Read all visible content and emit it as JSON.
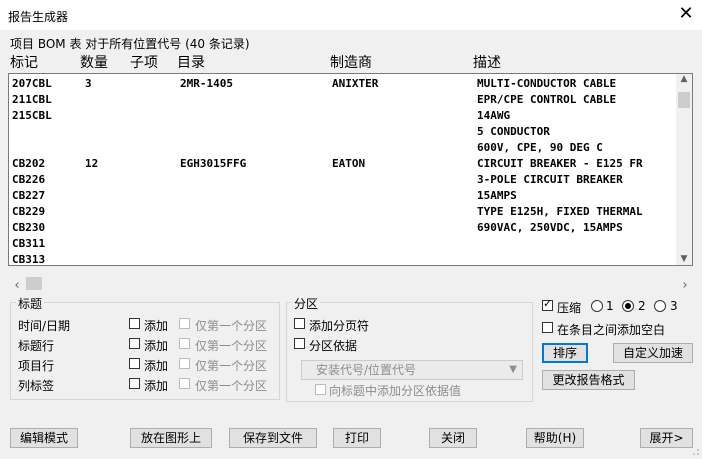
{
  "window": {
    "title": "报告生成器",
    "close": "✕"
  },
  "subtitle": "项目 BOM 表 对于所有位置代号 (40 条记录)",
  "columns": [
    "标记",
    "数量",
    "子项",
    "目录",
    "制造商",
    "描述"
  ],
  "rows": [
    {
      "tag": "207CBL",
      "qty": "3",
      "sub": "",
      "cat": "2MR-1405",
      "mfr": "ANIXTER",
      "desc": "MULTI-CONDUCTOR CABLE"
    },
    {
      "tag": "211CBL",
      "qty": "",
      "sub": "",
      "cat": "",
      "mfr": "",
      "desc": "EPR/CPE CONTROL CABLE"
    },
    {
      "tag": "215CBL",
      "qty": "",
      "sub": "",
      "cat": "",
      "mfr": "",
      "desc": "14AWG"
    },
    {
      "tag": "",
      "qty": "",
      "sub": "",
      "cat": "",
      "mfr": "",
      "desc": "5 CONDUCTOR"
    },
    {
      "tag": "",
      "qty": "",
      "sub": "",
      "cat": "",
      "mfr": "",
      "desc": "600V,  CPE, 90 DEG C"
    },
    {
      "tag": "CB202",
      "qty": "12",
      "sub": "",
      "cat": "EGH3015FFG",
      "mfr": "EATON",
      "desc": "CIRCUIT BREAKER - E125 FR"
    },
    {
      "tag": "CB226",
      "qty": "",
      "sub": "",
      "cat": "",
      "mfr": "",
      "desc": "3-POLE CIRCUIT BREAKER"
    },
    {
      "tag": "CB227",
      "qty": "",
      "sub": "",
      "cat": "",
      "mfr": "",
      "desc": "15AMPS"
    },
    {
      "tag": "CB229",
      "qty": "",
      "sub": "",
      "cat": "",
      "mfr": "",
      "desc": "TYPE E125H, FIXED THERMAL"
    },
    {
      "tag": "CB230",
      "qty": "",
      "sub": "",
      "cat": "",
      "mfr": "",
      "desc": "690VAC, 250VDC, 15AMPS"
    },
    {
      "tag": "CB311",
      "qty": "",
      "sub": "",
      "cat": "",
      "mfr": "",
      "desc": ""
    },
    {
      "tag": "CB313",
      "qty": "",
      "sub": "",
      "cat": "",
      "mfr": "",
      "desc": ""
    }
  ],
  "headings_group": {
    "legend": "标题",
    "items": [
      {
        "label": "时间/日期",
        "add": "添加",
        "first": "仅第一个分区"
      },
      {
        "label": "标题行",
        "add": "添加",
        "first": "仅第一个分区"
      },
      {
        "label": "项目行",
        "add": "添加",
        "first": "仅第一个分区"
      },
      {
        "label": "列标签",
        "add": "添加",
        "first": "仅第一个分区"
      }
    ]
  },
  "section_group": {
    "legend": "分区",
    "page_break": "添加分页符",
    "section_by": "分区依据",
    "select_value": "安装代号/位置代号",
    "add_value_label": "向标题中添加分区依据值"
  },
  "options": {
    "compress_label": "压缩",
    "compress_checked": true,
    "radio_labels": [
      "1",
      "2",
      "3"
    ],
    "radio_selected": "2",
    "blank_between": "在条目之间添加空白",
    "sort": "排序",
    "custom_speedup": "自定义加速",
    "change_format": "更改报告格式"
  },
  "bottom_buttons": {
    "edit_mode": "编辑模式",
    "place_in_drawing": "放在图形上",
    "save_to_file": "保存到文件",
    "print": "打印",
    "close": "关闭",
    "help": "帮助(H)",
    "expand": "展开>"
  }
}
